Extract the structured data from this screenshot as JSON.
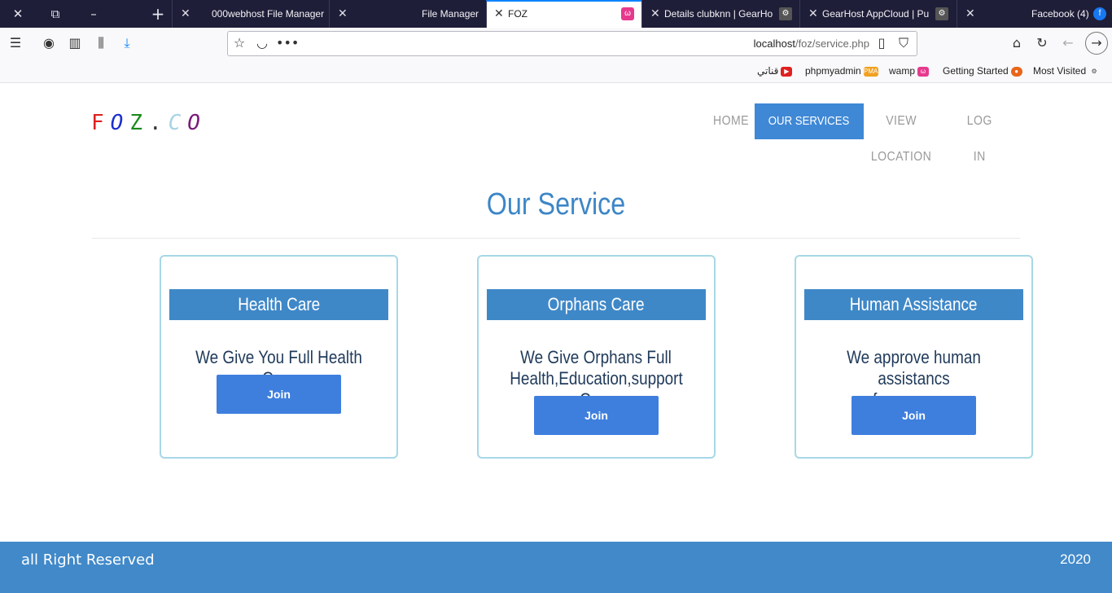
{
  "browser": {
    "tabs": [
      {
        "label": "000webhost File Manager",
        "active": false
      },
      {
        "label": "File Manager",
        "active": false
      },
      {
        "label": "FOZ",
        "active": true
      },
      {
        "label": "Details clubknn | GearHo",
        "active": false
      },
      {
        "label": "GearHost AppCloud | Pu",
        "active": false
      },
      {
        "label": "Facebook (4)",
        "active": false
      }
    ],
    "url_host": "localhost",
    "url_path": "/foz/service.php",
    "bookmarks": [
      "قناتي",
      "phpmyadmin",
      "wamp",
      "Getting Started",
      "Most Visited"
    ]
  },
  "site": {
    "logo": {
      "f": "F",
      "o": "O",
      "z": "Z",
      "dot": ".",
      "c": "C",
      "o2": "O"
    },
    "nav": [
      "HOME",
      "OUR SERVICES",
      "VIEW LOCATION",
      "LOG IN"
    ],
    "active_nav": "OUR SERVICES",
    "title": "Our Service",
    "cards": [
      {
        "heading": "Health Care",
        "desc_line1": "We Give You Full Health Care",
        "desc_line2": "",
        "button": "Join"
      },
      {
        "heading": "Orphans Care",
        "desc_line1": "We Give Orphans Full",
        "desc_line2": "Health,Education,support Care",
        "button": "Join"
      },
      {
        "heading": "Human Assistance",
        "desc_line1": "We approve human assistancs",
        "desc_line2": "for evry one",
        "button": "Join"
      }
    ],
    "footer_left": "all Right Reserved",
    "footer_right": "2020"
  },
  "colors": {
    "accent": "#3f88c8",
    "button": "#3e7fde",
    "card_border": "#a7d8e6",
    "title": "#3d86c6",
    "footer": "#4189c9"
  }
}
